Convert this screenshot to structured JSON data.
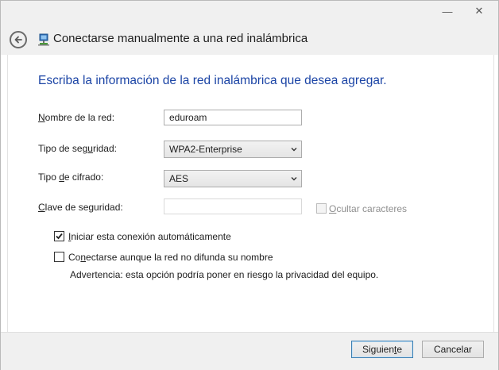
{
  "window": {
    "controls": {
      "minimize": "—",
      "close": "✕"
    }
  },
  "header": {
    "title": "Conectarse manualmente a una red inalámbrica",
    "back_icon": "back-arrow-icon",
    "network_icon": "wireless-network-icon"
  },
  "form": {
    "instruction": "Escriba la información de la red inalámbrica que desea agregar.",
    "network_name": {
      "label_prefix": "",
      "label_accel": "N",
      "label_rest": "ombre de la red:",
      "value": "eduroam"
    },
    "security_type": {
      "label_prefix": "Tipo de seg",
      "label_accel": "u",
      "label_rest": "ridad:",
      "value": "WPA2-Enterprise"
    },
    "encryption_type": {
      "label_prefix": "Tipo ",
      "label_accel": "d",
      "label_rest": "e cifrado:",
      "value": "AES"
    },
    "security_key": {
      "label_prefix": "",
      "label_accel": "C",
      "label_rest": "lave de seguridad:",
      "value": ""
    },
    "hide_characters": {
      "label_prefix": "",
      "label_accel": "O",
      "label_rest": "cultar caracteres",
      "checked": false,
      "enabled": false
    },
    "auto_connect": {
      "label_prefix": "",
      "label_accel": "I",
      "label_rest": "niciar esta conexión automáticamente",
      "checked": true
    },
    "connect_hidden": {
      "label_prefix": "Co",
      "label_accel": "n",
      "label_rest": "ectarse aunque la red no difunda su nombre",
      "checked": false
    },
    "warning": "Advertencia: esta opción podría poner en riesgo la privacidad del equipo."
  },
  "footer": {
    "next": {
      "label_prefix": "Siguien",
      "label_accel": "t",
      "label_rest": "e"
    },
    "cancel": "Cancelar"
  },
  "colors": {
    "instruction_text": "#1b44a5",
    "chrome_bg": "#f0f0f0"
  }
}
